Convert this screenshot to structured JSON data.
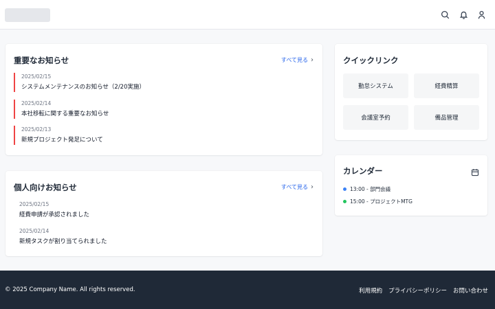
{
  "header": {
    "icons": [
      "search-icon",
      "bell-icon",
      "user-icon"
    ]
  },
  "important_notices": {
    "title": "重要なお知らせ",
    "see_all": "すべて見る",
    "items": [
      {
        "date": "2025/02/15",
        "title": "システムメンテナンスのお知らせ（2/20実施）"
      },
      {
        "date": "2025/02/14",
        "title": "本社移転に関する重要なお知らせ"
      },
      {
        "date": "2025/02/13",
        "title": "新規プロジェクト発足について"
      }
    ]
  },
  "personal_notices": {
    "title": "個人向けお知らせ",
    "see_all": "すべて見る",
    "items": [
      {
        "date": "2025/02/15",
        "title": "経費申請が承認されました"
      },
      {
        "date": "2025/02/14",
        "title": "新規タスクが割り当てられました"
      }
    ]
  },
  "quick_links": {
    "title": "クイックリンク",
    "items": [
      "勤怠システム",
      "経費精算",
      "会議室予約",
      "備品管理"
    ]
  },
  "calendar": {
    "title": "カレンダー",
    "events": [
      {
        "text": "13:00 - 部門会議",
        "color": "#3b82f6"
      },
      {
        "text": "15:00 - プロジェクトMTG",
        "color": "#22c55e"
      }
    ]
  },
  "footer": {
    "copyright": "© 2025 Company Name. All rights reserved.",
    "links": [
      "利用規約",
      "プライバシーポリシー",
      "お問い合わせ"
    ]
  },
  "colors": {
    "accent": "#2563eb",
    "important_border": "#ef4444",
    "footer_bg": "#1f2937"
  }
}
